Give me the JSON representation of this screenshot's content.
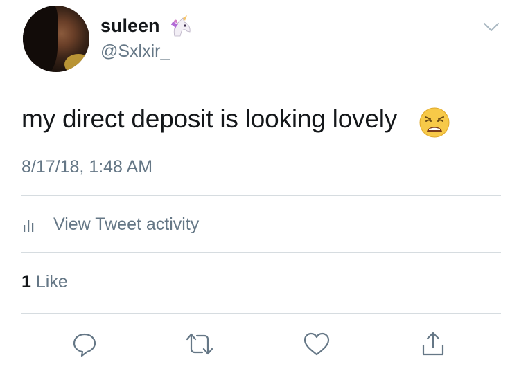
{
  "author": {
    "display_name": "suleen",
    "name_emoji": "unicorn-icon",
    "handle": "@Sxlxir_"
  },
  "tweet": {
    "text": "my direct deposit is looking lovely",
    "text_emoji": "weary-face-icon",
    "timestamp": "8/17/18, 1:48 AM"
  },
  "activity": {
    "label": "View Tweet activity",
    "icon": "bar-chart-icon"
  },
  "engagement": {
    "like_count": "1",
    "like_label": "Like"
  },
  "actions": [
    {
      "name": "reply",
      "icon": "reply-icon"
    },
    {
      "name": "retweet",
      "icon": "retweet-icon"
    },
    {
      "name": "like",
      "icon": "heart-icon"
    },
    {
      "name": "share",
      "icon": "share-icon"
    }
  ],
  "colors": {
    "text_primary": "#14171a",
    "text_secondary": "#657786",
    "divider": "#d6dce0",
    "icon": "#657786"
  }
}
